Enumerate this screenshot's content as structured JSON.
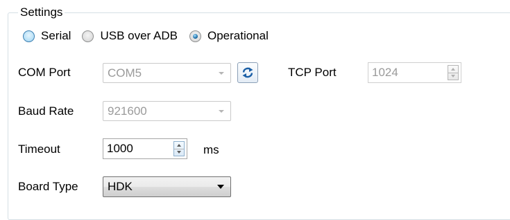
{
  "group": {
    "title": "Settings"
  },
  "connection": {
    "options": [
      {
        "label": "Serial",
        "selected": false,
        "state": "hover"
      },
      {
        "label": "USB over ADB",
        "selected": false,
        "state": "normal"
      },
      {
        "label": "Operational",
        "selected": true,
        "state": "normal"
      }
    ]
  },
  "com_port": {
    "label": "COM Port",
    "value": "COM5",
    "enabled": false
  },
  "refresh": {
    "icon": "refresh-icon"
  },
  "tcp_port": {
    "label": "TCP Port",
    "value": "1024",
    "enabled": false
  },
  "baud_rate": {
    "label": "Baud Rate",
    "value": "921600",
    "enabled": false
  },
  "timeout": {
    "label": "Timeout",
    "value": "1000",
    "unit": "ms",
    "enabled": true
  },
  "board_type": {
    "label": "Board Type",
    "value": "HDK",
    "enabled": true
  },
  "colors": {
    "accent": "#1f6fa8",
    "disabled_text": "#9a9a9a",
    "group_border": "#d5dfe5"
  }
}
